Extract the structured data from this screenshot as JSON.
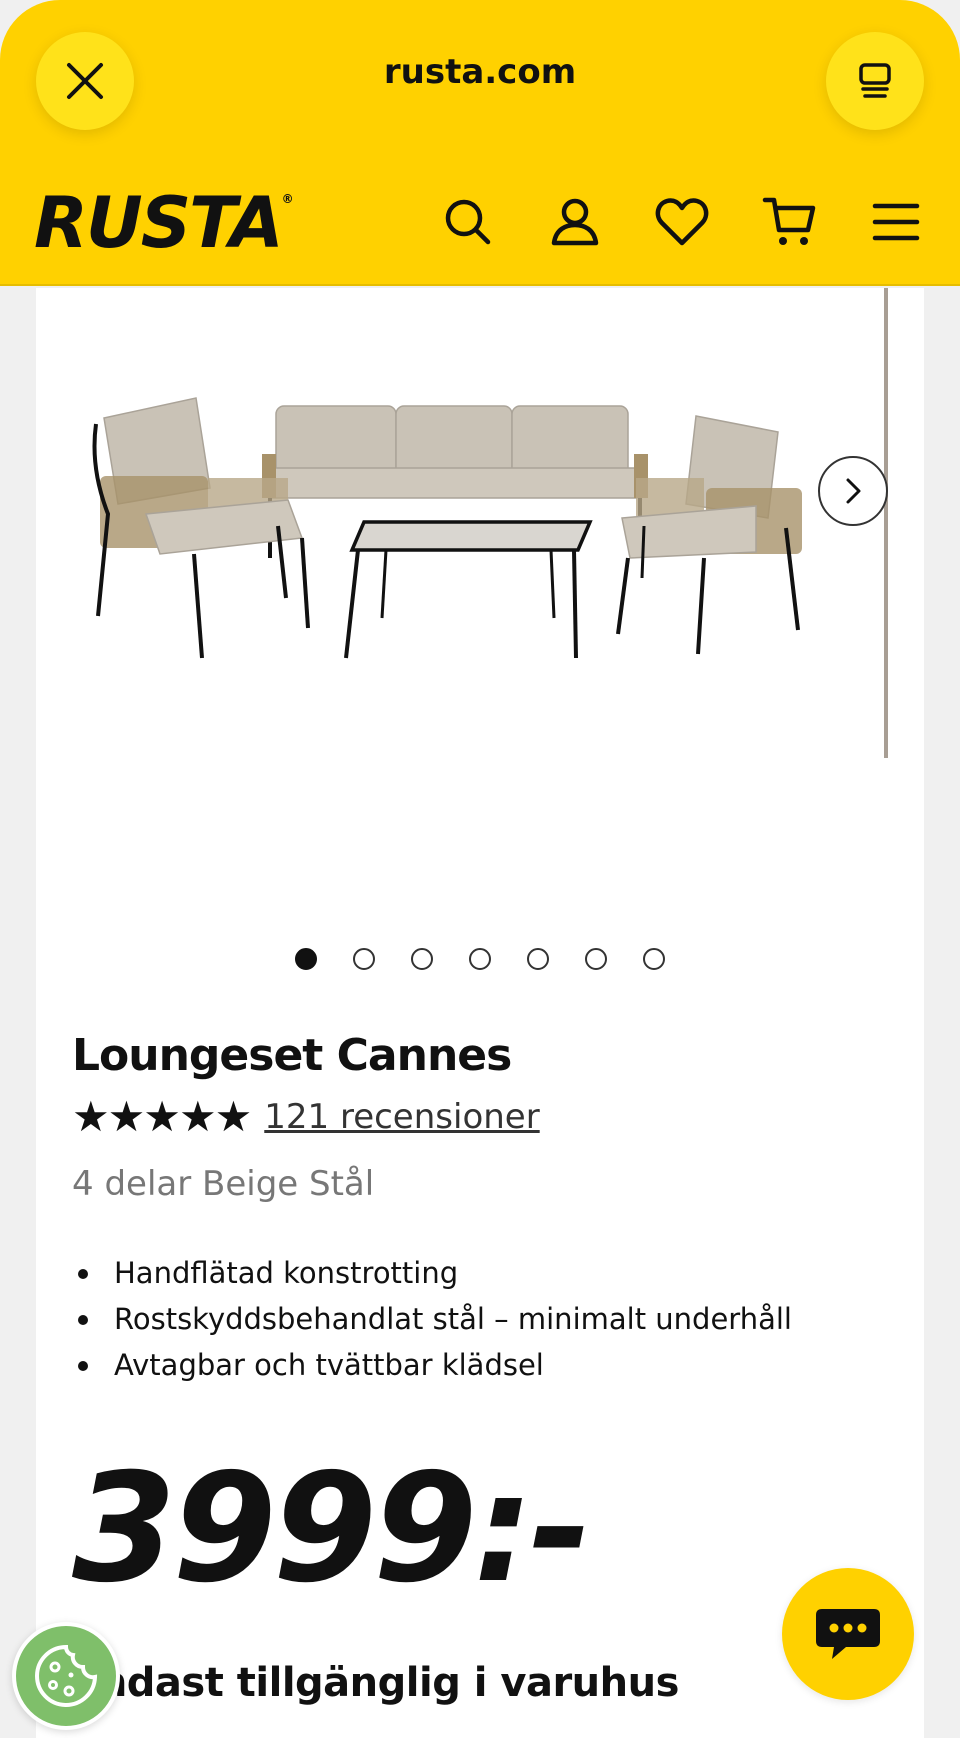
{
  "browser": {
    "url": "rusta.com",
    "close_icon": "close-icon",
    "tabs_icon": "tabs-icon"
  },
  "header": {
    "logo": "RUSTA",
    "logo_mark": "®",
    "icons": [
      "search-icon",
      "account-icon",
      "heart-icon",
      "cart-icon",
      "menu-icon"
    ]
  },
  "product": {
    "title": "Loungeset Cannes",
    "rating_stars": "★★★★★",
    "rating_value": 4.8,
    "reviews_label": "121 recensioner",
    "variant": "4 delar Beige Stål",
    "features": [
      "Handflätad konstrotting",
      "Rostskyddsbehandlat stål – minimalt underhåll",
      "Avtagbar och tvättbar klädsel"
    ],
    "price": "3999:-",
    "availability": "Endast tillgänglig i varuhus",
    "image_count": 7,
    "active_image": 1
  },
  "colors": {
    "brand_yellow": "#ffd100",
    "cushion_beige": "#c9c2b6",
    "frame_black": "#111111"
  }
}
